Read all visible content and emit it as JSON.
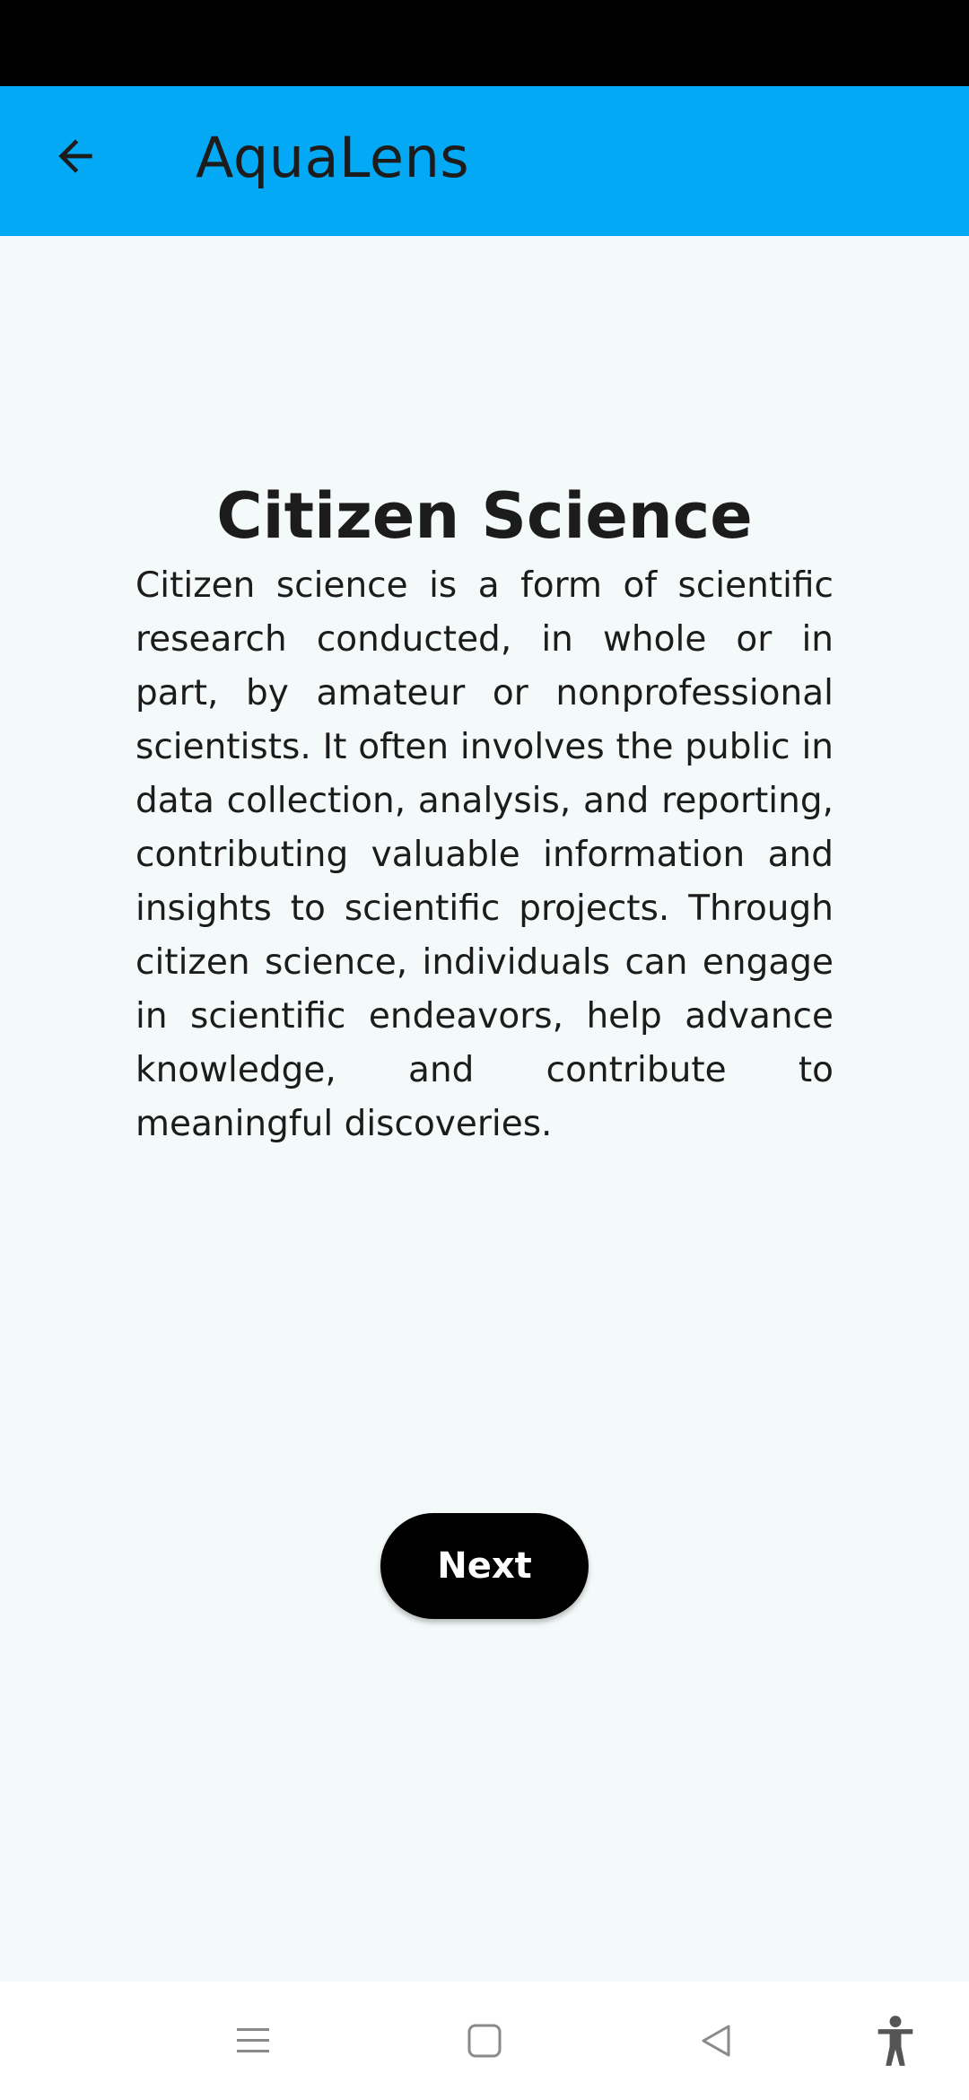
{
  "app_bar": {
    "title": "AquaLens",
    "back_icon": "arrow-left-icon",
    "background": "#03a9f4"
  },
  "main": {
    "heading": "Citizen Science",
    "body": "Citizen science is a form of scientific research conducted, in whole or in part, by amateur or nonprofessional scientists. It often involves the public in data collection, analysis, and reporting, contributing valuable information and insights to scientific projects. Through citizen science, individuals can engage in scientific endeavors, help advance knowledge, and contribute to meaningful discoveries.",
    "next_label": "Next"
  },
  "nav_bar": {
    "icons": [
      "menu-icon",
      "home-square-icon",
      "back-triangle-icon",
      "accessibility-icon"
    ]
  }
}
